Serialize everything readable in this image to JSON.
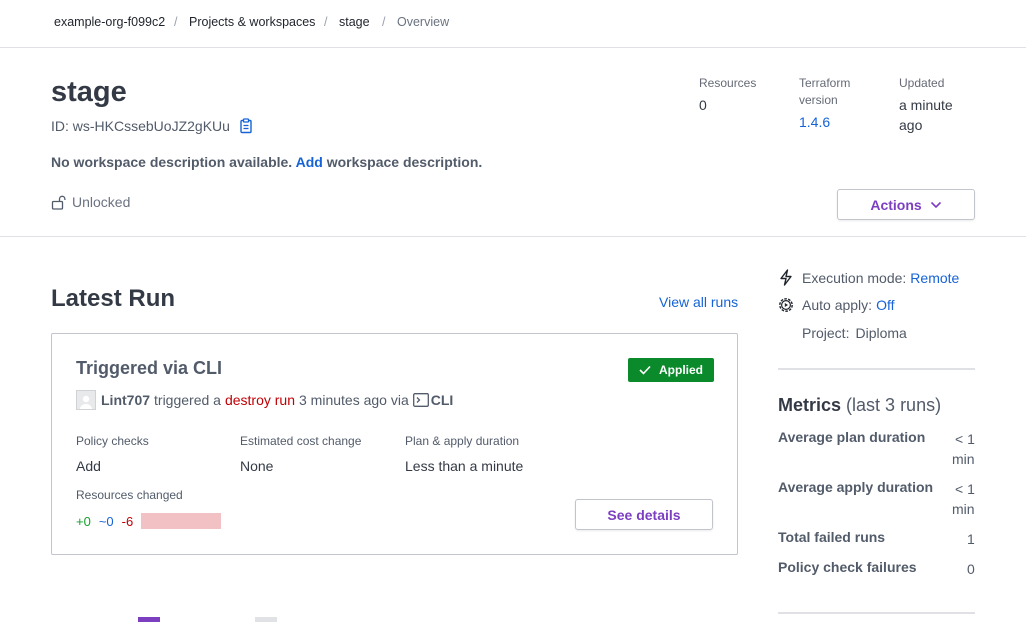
{
  "breadcrumb": {
    "org": "example-org-f099c2",
    "projects": "Projects & workspaces",
    "workspace": "stage",
    "current": "Overview",
    "separator": "/"
  },
  "workspace": {
    "name": "stage",
    "id_label": "ID: ws-HKCssebUoJZ2gKUu",
    "description_prefix": "No workspace description available.",
    "description_link": "Add",
    "description_suffix": "workspace description.",
    "lock_status": "Unlocked"
  },
  "stats": {
    "resources_label": "Resources",
    "resources_value": "0",
    "tf_label_1": "Terraform",
    "tf_label_2": "version",
    "tf_value": "1.4.6",
    "updated_label": "Updated",
    "updated_value_1": "a minute",
    "updated_value_2": "ago"
  },
  "actions_label": "Actions",
  "latest_run": {
    "heading": "Latest Run",
    "view_all": "View all runs",
    "title": "Triggered via CLI",
    "status": "Applied",
    "user": "Lint707",
    "triggered_text": "triggered a",
    "run_type": "destroy run",
    "time_text": "3 minutes ago via",
    "source": "CLI",
    "policy_label": "Policy checks",
    "policy_value": "Add",
    "cost_label": "Estimated cost change",
    "cost_value": "None",
    "duration_label": "Plan & apply duration",
    "duration_value": "Less than a minute",
    "resources_label": "Resources changed",
    "added": "+0",
    "changed": "~0",
    "destroyed": "-6",
    "see_details": "See details"
  },
  "sidebar": {
    "execution_label": "Execution mode:",
    "execution_value": "Remote",
    "auto_apply_label": "Auto apply:",
    "auto_apply_value": "Off",
    "project_label": "Project:",
    "project_value": "Diploma"
  },
  "metrics": {
    "title": "Metrics",
    "subtitle": "(last 3 runs)",
    "avg_plan_label": "Average plan duration",
    "avg_plan_value_1": "< 1",
    "avg_plan_value_2": "min",
    "avg_apply_label": "Average apply duration",
    "avg_apply_value_1": "< 1",
    "avg_apply_value_2": "min",
    "failed_label": "Total failed runs",
    "failed_value": "1",
    "policy_fail_label": "Policy check failures",
    "policy_fail_value": "0"
  },
  "colors": {
    "accent": "#7b3fc0",
    "link": "#1563d6",
    "success": "#0a8a2b",
    "danger": "#c00005"
  }
}
